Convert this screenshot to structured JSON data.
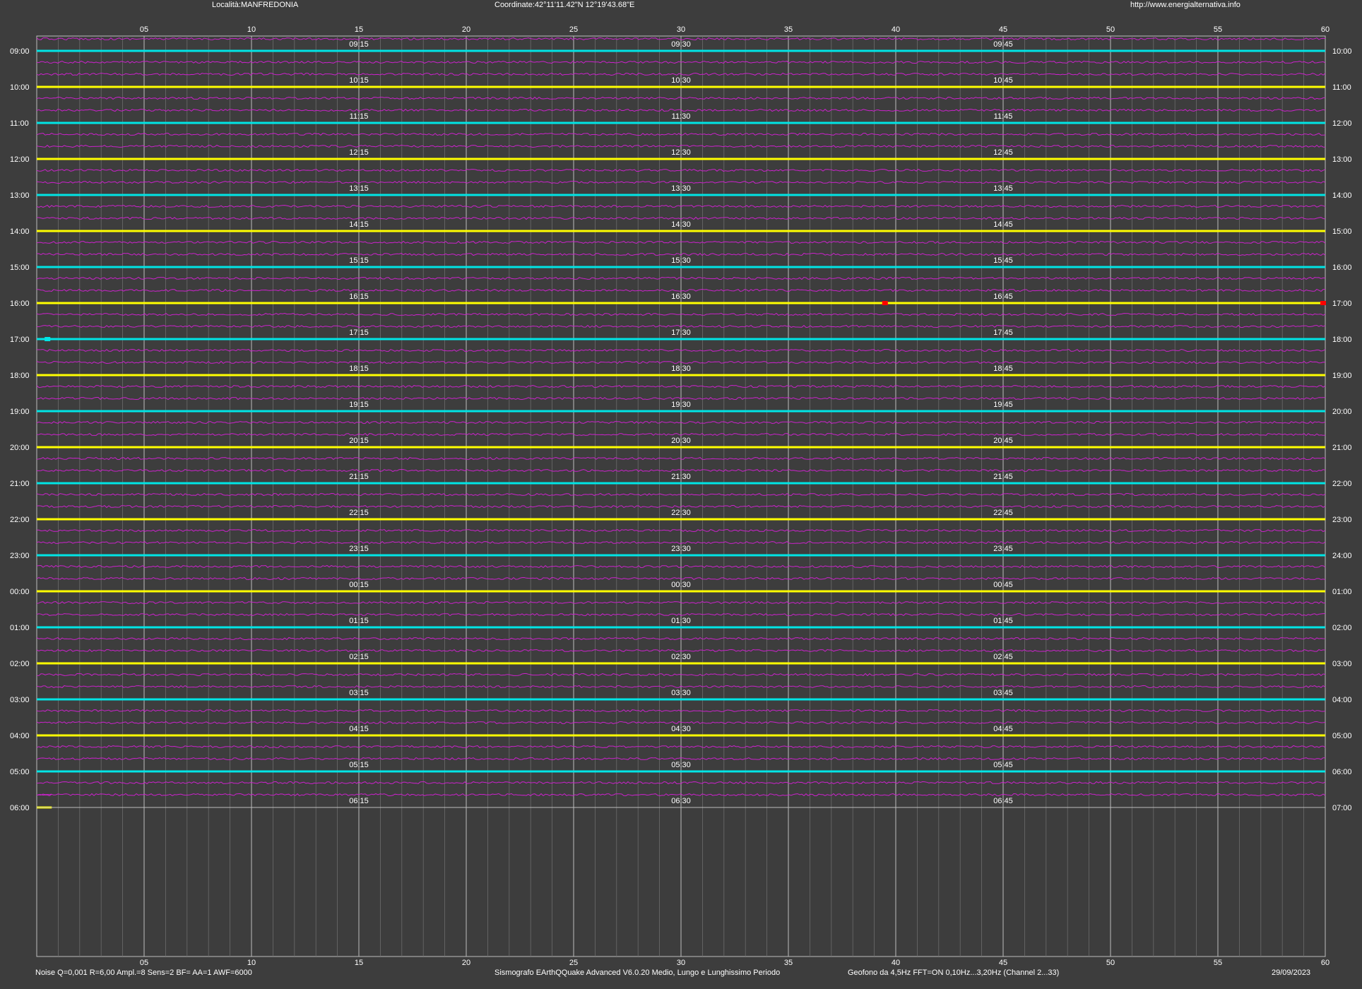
{
  "header": {
    "location": "Località:MANFREDONIA",
    "coordinates": "Coordinate:42°11'11.42\"N  12°19'43.68\"E",
    "website": "http://www.energialternativa.info"
  },
  "footer": {
    "settings": "Noise Q=0,001 R=6,00 Ampl.=8 Sens=2 BF= AA=1 AWF=6000",
    "software": "Sismografo  EArthQQuake Advanced V6.0.20  Medio, Lungo e Lunghissimo Periodo",
    "sensor": "Geofono da 4,5Hz FFT=ON 0,10Hz...3,20Hz      (Channel 2...33)",
    "date": "29/09/2023"
  },
  "colors": {
    "background": "#3d3d3d",
    "grid_minor": "#6c6c6c",
    "grid_major": "#bdbdbd",
    "trace_cyan": "#00e5e5",
    "trace_yellow": "#ffff00",
    "noise_trace": "#cc22cc",
    "event_marker": "#ff0000",
    "text": "#ffffff"
  },
  "chart_data": {
    "type": "line",
    "description_type": "helicorder",
    "x_unit": "minutes",
    "xlim": [
      0,
      60
    ],
    "x_tick_labels": [
      "05",
      "10",
      "15",
      "20",
      "25",
      "30",
      "35",
      "40",
      "45",
      "50",
      "55",
      "60"
    ],
    "row_colors_alternate": [
      "cyan",
      "yellow"
    ],
    "left_hour_labels": [
      "09:00",
      "10:00",
      "11:00",
      "12:00",
      "13:00",
      "14:00",
      "15:00",
      "16:00",
      "17:00",
      "18:00",
      "19:00",
      "20:00",
      "21:00",
      "22:00",
      "23:00",
      "00:00",
      "01:00",
      "02:00",
      "03:00",
      "04:00",
      "05:00",
      "06:00"
    ],
    "right_hour_labels": [
      "10:00",
      "11:00",
      "12:00",
      "13:00",
      "14:00",
      "15:00",
      "16:00",
      "17:00",
      "18:00",
      "19:00",
      "20:00",
      "21:00",
      "22:00",
      "23:00",
      "24:00",
      "01:00",
      "02:00",
      "03:00",
      "04:00",
      "05:00",
      "06:00",
      "07:00"
    ],
    "quarter_marks": [
      [
        "09:15",
        "09:30",
        "09:45"
      ],
      [
        "10:15",
        "10:30",
        "10:45"
      ],
      [
        "11:15",
        "11:30",
        "11:45"
      ],
      [
        "12:15",
        "12:30",
        "12:45"
      ],
      [
        "13:15",
        "13:30",
        "13:45"
      ],
      [
        "14:15",
        "14:30",
        "14:45"
      ],
      [
        "15:15",
        "15:30",
        "15:45"
      ],
      [
        "16:15",
        "16:30",
        "16:45"
      ],
      [
        "17:15",
        "17:30",
        "17:45"
      ],
      [
        "18:15",
        "18:30",
        "18:45"
      ],
      [
        "19:15",
        "19:30",
        "19:45"
      ],
      [
        "20:15",
        "20:30",
        "20:45"
      ],
      [
        "21:15",
        "21:30",
        "21:45"
      ],
      [
        "22:15",
        "22:30",
        "22:45"
      ],
      [
        "23:15",
        "23:30",
        "23:45"
      ],
      [
        "00:15",
        "00:30",
        "00:45"
      ],
      [
        "01:15",
        "01:30",
        "01:45"
      ],
      [
        "02:15",
        "02:30",
        "02:45"
      ],
      [
        "03:15",
        "03:30",
        "03:45"
      ],
      [
        "04:15",
        "04:30",
        "04:45"
      ],
      [
        "05:15",
        "05:30",
        "05:45"
      ],
      [
        "06:15",
        "06:30",
        "06:45"
      ]
    ],
    "last_row_recorded_until_minute": 0.7,
    "events": [
      {
        "hour": "16:00",
        "minute": 39.5
      },
      {
        "hour": "16:00",
        "minute": 59.9
      },
      {
        "hour": "17:00",
        "minute": 0.5
      }
    ]
  }
}
